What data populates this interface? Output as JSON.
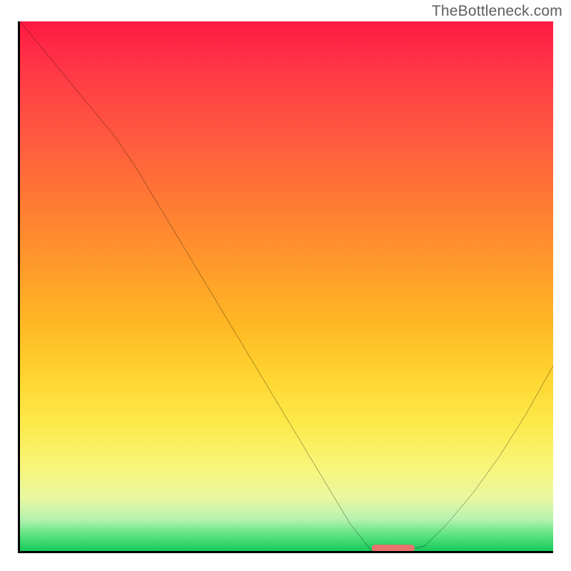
{
  "watermark": "TheBottleneck.com",
  "chart_data": {
    "type": "line",
    "title": "",
    "xlabel": "",
    "ylabel": "",
    "xlim": [
      0,
      100
    ],
    "ylim": [
      0,
      100
    ],
    "grid": false,
    "series": [
      {
        "name": "curve",
        "x": [
          0,
          18,
          20,
          22,
          62,
          66,
          72,
          76,
          80,
          85,
          90,
          95,
          100
        ],
        "values": [
          100,
          78,
          75,
          72,
          5,
          0,
          0,
          1,
          5,
          11,
          18,
          26,
          35
        ]
      }
    ],
    "marker": {
      "name": "target-marker",
      "x_start": 66,
      "x_end": 74,
      "y": 0.5,
      "color": "#e8736a"
    },
    "gradient_stops": [
      {
        "pos": 0,
        "color": "#ff1a44"
      },
      {
        "pos": 10,
        "color": "#ff3a46"
      },
      {
        "pos": 22,
        "color": "#ff5a3f"
      },
      {
        "pos": 34,
        "color": "#ff7a34"
      },
      {
        "pos": 46,
        "color": "#ff9a2a"
      },
      {
        "pos": 58,
        "color": "#ffba24"
      },
      {
        "pos": 68,
        "color": "#ffd733"
      },
      {
        "pos": 76,
        "color": "#fcea4a"
      },
      {
        "pos": 84,
        "color": "#f9f57a"
      },
      {
        "pos": 90,
        "color": "#e9f8a0"
      },
      {
        "pos": 94,
        "color": "#b6f2b0"
      },
      {
        "pos": 97,
        "color": "#5be37f"
      },
      {
        "pos": 100,
        "color": "#15c85a"
      }
    ]
  }
}
